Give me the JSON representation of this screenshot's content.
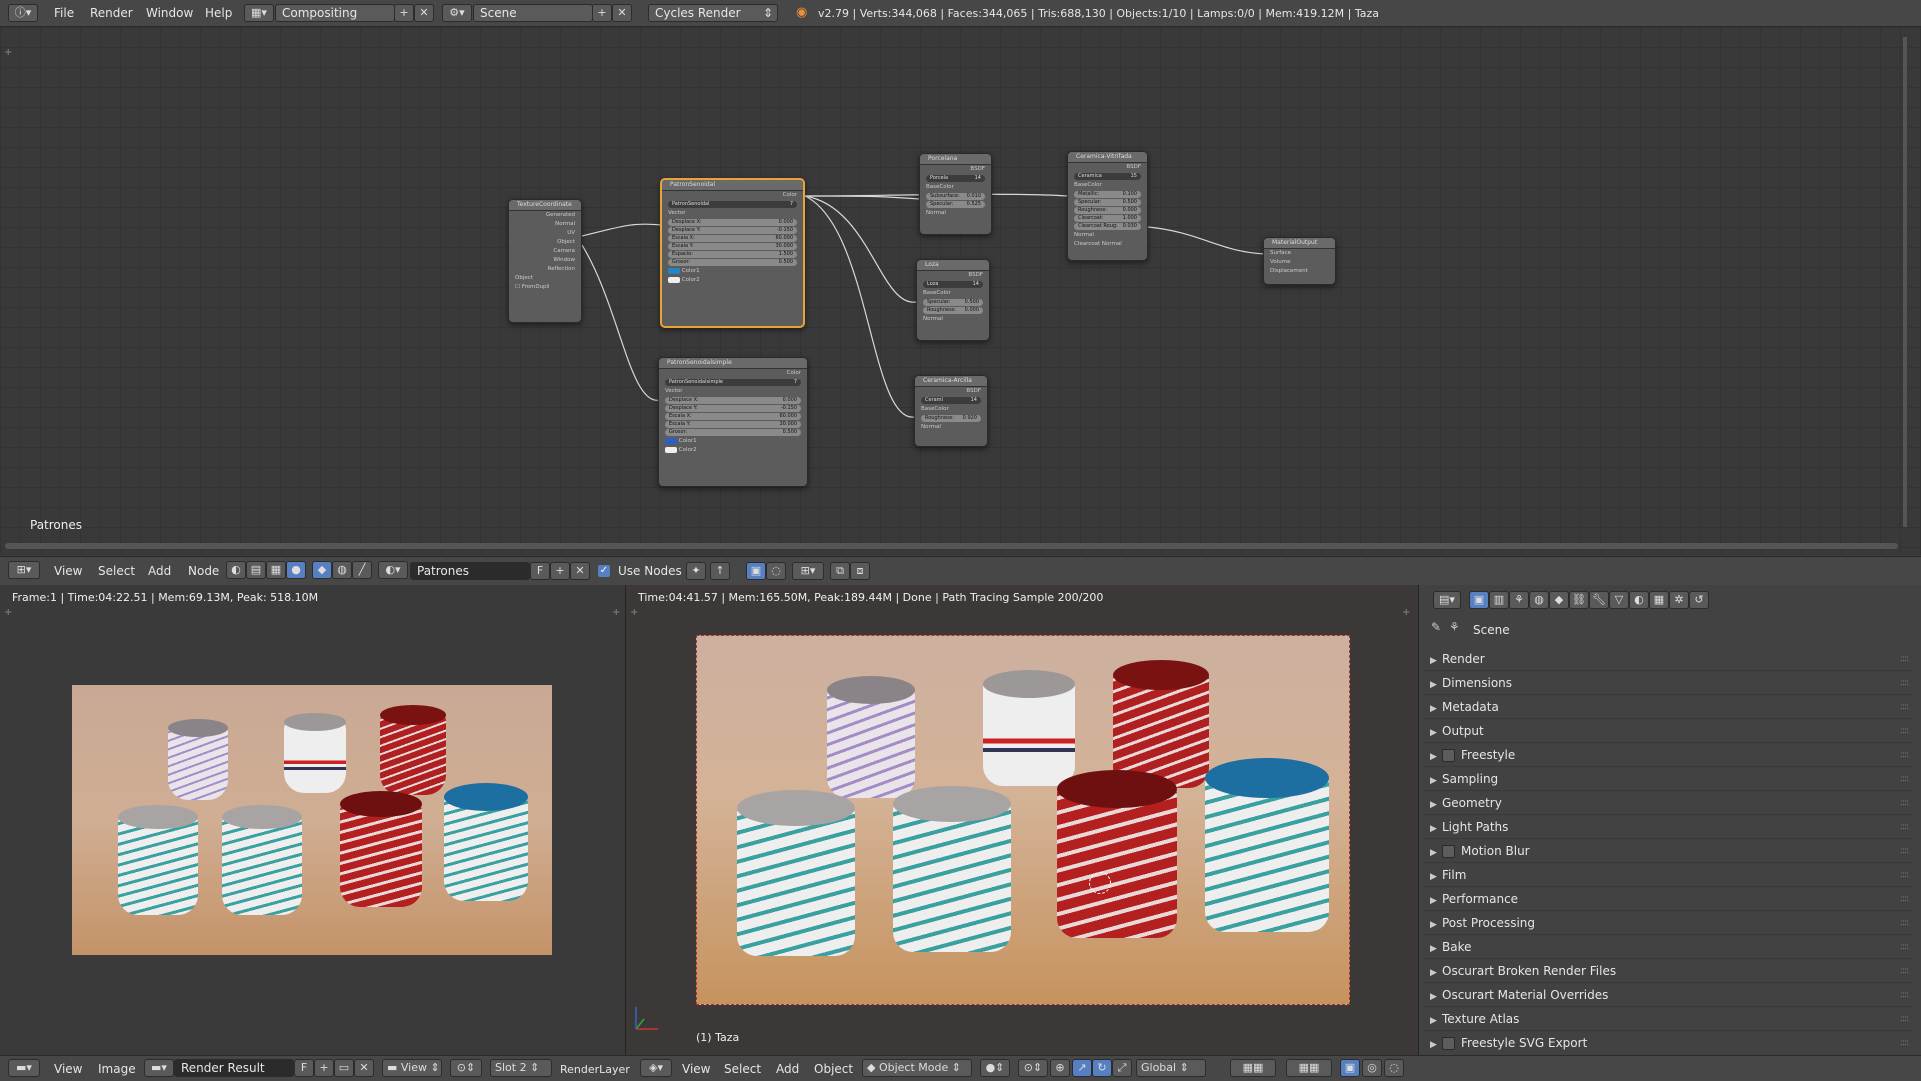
{
  "topbar": {
    "menus": [
      "File",
      "Render",
      "Window",
      "Help"
    ],
    "screen_layout": "Compositing",
    "scene": "Scene",
    "render_engine": "Cycles Render",
    "stats": "v2.79 | Verts:344,068 | Faces:344,065 | Tris:688,130 | Objects:1/10 | Lamps:0/0 | Mem:419.12M | Taza"
  },
  "node_editor": {
    "label": "Patrones",
    "nodes": {
      "texcoord": {
        "title": "TextureCoordinate",
        "outputs": [
          "Generated",
          "Normal",
          "UV",
          "Object",
          "Camera",
          "Window",
          "Reflection"
        ],
        "object_label": "Object",
        "fromdupli": "FromDupli"
      },
      "sinusoidal": {
        "title": "PatronSenoidal",
        "out": "Color",
        "datablock": "PatronSenoidal",
        "users": "7",
        "vector": "Vector",
        "fields": [
          [
            "Desplace X:",
            "0.000"
          ],
          [
            "Desplace Y:",
            "-0.150"
          ],
          [
            "Escala X:",
            "60.000"
          ],
          [
            "Escala Y:",
            "30.000"
          ],
          [
            "Espacio:",
            "1.500"
          ],
          [
            "Grosor:",
            "0.500"
          ]
        ],
        "colors": [
          "Color1",
          "Color2"
        ]
      },
      "sinusoidal_simple": {
        "title": "PatronSenoidalsimple",
        "out": "Color",
        "datablock": "PatronSenoidalsimple",
        "users": "7",
        "vector": "Vector",
        "fields": [
          [
            "Desplace X:",
            "0.000"
          ],
          [
            "Desplace Y:",
            "-0.150"
          ],
          [
            "Escala X:",
            "60.000"
          ],
          [
            "Escala Y:",
            "30.000"
          ],
          [
            "Grosor:",
            "0.500"
          ]
        ],
        "colors": [
          "Color1",
          "Color2"
        ]
      },
      "porcelana": {
        "title": "Porcelana",
        "out": "BSDF",
        "datablock": "Porcela",
        "users": "14",
        "fields": [
          [
            "Subsurface:",
            "0.010"
          ],
          [
            "Specular:",
            "0.525"
          ]
        ],
        "inputs": [
          "BaseColor",
          "Normal"
        ]
      },
      "loza": {
        "title": "Loza",
        "out": "BSDF",
        "datablock": "Loza",
        "users": "14",
        "fields": [
          [
            "Specular:",
            "0.500"
          ],
          [
            "Roughness:",
            "0.000"
          ]
        ],
        "inputs": [
          "BaseColor",
          "Normal"
        ]
      },
      "ceramica": {
        "title": "Ceramica-Arcilla",
        "out": "BSDF",
        "datablock": "Ceramí",
        "users": "14",
        "fields": [
          [
            "Roughness:",
            "0.920"
          ]
        ],
        "inputs": [
          "BaseColor",
          "Normal"
        ]
      },
      "vitrificada": {
        "title": "Ceramica-Vitrifada",
        "out": "BSDF",
        "datablock": "Ceramica",
        "users": "15",
        "fields": [
          [
            "Metallic:",
            "0.100"
          ],
          [
            "Specular:",
            "0.500"
          ],
          [
            "Roughness:",
            "0.000"
          ],
          [
            "Clearcoat:",
            "1.000"
          ],
          [
            "Clearcoat Roug:",
            "0.030"
          ]
        ],
        "inputs": [
          "BaseColor",
          "Normal",
          "Clearcoat Normal"
        ]
      },
      "output": {
        "title": "MaterialOutput",
        "inputs": [
          "Surface",
          "Volume",
          "Displacement"
        ]
      }
    }
  },
  "node_header": {
    "menus": [
      "View",
      "Select",
      "Add",
      "Node"
    ],
    "material": "Patrones",
    "fake_user": "F",
    "use_nodes": "Use Nodes"
  },
  "image_editor": {
    "status": "Frame:1 | Time:04:22.51 | Mem:69.13M, Peak: 518.10M",
    "menus": [
      "View",
      "Image"
    ],
    "image_name": "Render Result",
    "fake_user": "F",
    "view": "View",
    "slot": "Slot 2",
    "layer": "RenderLayer"
  },
  "viewport": {
    "status": "Time:04:41.57 | Mem:165.50M, Peak:189.44M | Done | Path Tracing Sample 200/200",
    "object_label": "(1) Taza",
    "menus": [
      "View",
      "Select",
      "Add",
      "Object"
    ],
    "mode": "Object Mode",
    "orientation": "Global"
  },
  "properties": {
    "scene_label": "Scene",
    "panels": [
      {
        "label": "Render",
        "check": false
      },
      {
        "label": "Dimensions",
        "check": false
      },
      {
        "label": "Metadata",
        "check": false
      },
      {
        "label": "Output",
        "check": false
      },
      {
        "label": "Freestyle",
        "check": true
      },
      {
        "label": "Sampling",
        "check": false
      },
      {
        "label": "Geometry",
        "check": false
      },
      {
        "label": "Light Paths",
        "check": false
      },
      {
        "label": "Motion Blur",
        "check": true
      },
      {
        "label": "Film",
        "check": false
      },
      {
        "label": "Performance",
        "check": false
      },
      {
        "label": "Post Processing",
        "check": false
      },
      {
        "label": "Bake",
        "check": false
      },
      {
        "label": "Oscurart Broken Render Files",
        "check": false
      },
      {
        "label": "Oscurart Material Overrides",
        "check": false
      },
      {
        "label": "Texture Atlas",
        "check": false
      },
      {
        "label": "Freestyle SVG Export",
        "check": true
      }
    ]
  },
  "colors": {
    "accent_orange": "#e8a33a",
    "header_bg": "#474747",
    "node_bg": "#5c5c5c",
    "socket_yellow": "#c7c729",
    "socket_purple": "#6363c7",
    "socket_green": "#63c763"
  }
}
